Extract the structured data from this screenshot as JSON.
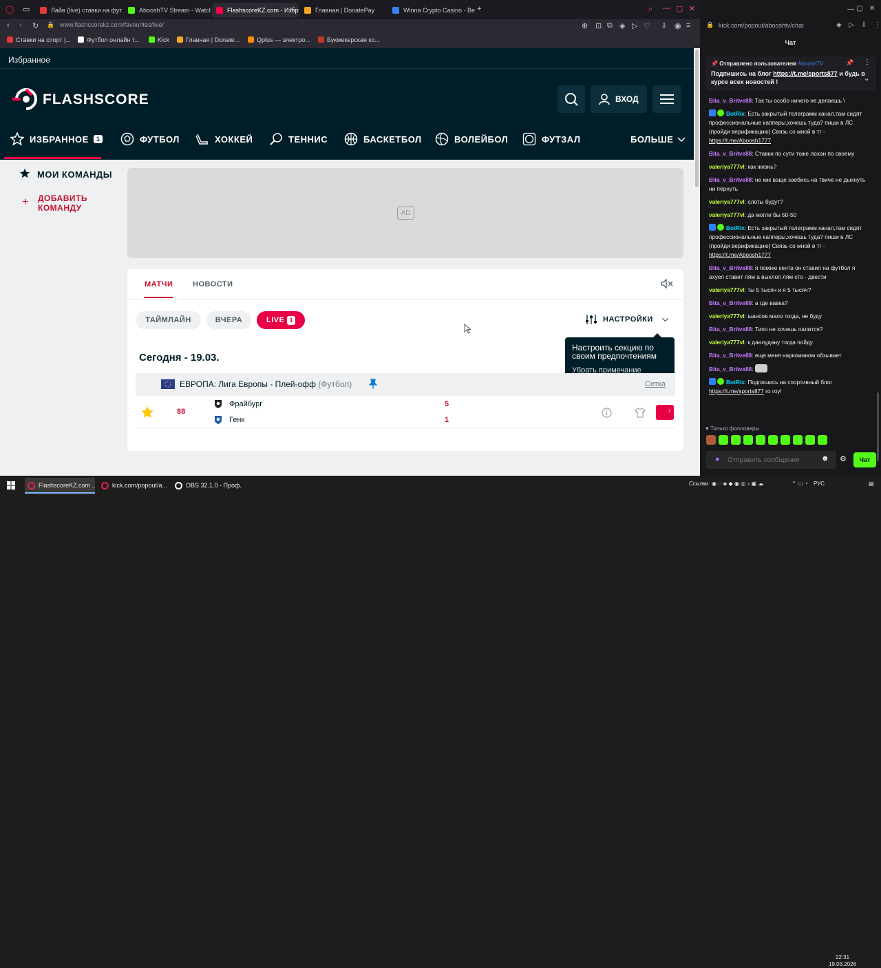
{
  "browser": {
    "tabs": [
      {
        "label": "Лайв (live) ставки на фут",
        "color": "#e53935"
      },
      {
        "label": "AbooshTV Stream - Watch",
        "color": "#53fc18"
      },
      {
        "label": "FlashscoreKZ.com - Избр",
        "color": "#ff0046"
      },
      {
        "label": "Главная | DonatePay",
        "color": "#f5a623"
      },
      {
        "label": "Winna Crypto Casino - Be",
        "color": "#3b82f6"
      }
    ],
    "url": "www.flashscorekz.com/favourites/live/",
    "bookmarks": [
      {
        "label": "Ставки на спорт |...",
        "color": "#e53935"
      },
      {
        "label": "Футбол онлайн т...",
        "color": "#ffffff"
      },
      {
        "label": "Kick",
        "color": "#53fc18"
      },
      {
        "label": "Главная | Donate...",
        "color": "#f5a623"
      },
      {
        "label": "Qplus — электро...",
        "color": "#ff8c00"
      },
      {
        "label": "Букмекерская ко...",
        "color": "#c0392b"
      }
    ]
  },
  "flashscore": {
    "favorites_header": "Избранное",
    "logo": "FLASHSCORE",
    "login": "ВХОД",
    "nav": [
      {
        "label": "ИЗБРАННОЕ",
        "badge": "1"
      },
      {
        "label": "ФУТБОЛ"
      },
      {
        "label": "ХОККЕЙ"
      },
      {
        "label": "ТЕННИС"
      },
      {
        "label": "БАСКЕТБОЛ"
      },
      {
        "label": "ВОЛЕЙБОЛ"
      },
      {
        "label": "ФУТЗАЛ"
      },
      {
        "label": "БОЛЬШЕ"
      }
    ],
    "sidebar": {
      "my_teams": "МОИ КОМАНДЫ",
      "add_team_line1": "ДОБАВИТЬ",
      "add_team_line2": "КОМАНДУ"
    },
    "ad_label": "AD",
    "content_tabs": [
      "МАТЧИ",
      "НОВОСТИ"
    ],
    "filters": {
      "timeline": "ТАЙМЛАЙН",
      "yesterday": "ВЧЕРА",
      "live": "LIVE",
      "live_count": "1"
    },
    "settings_label": "НАСТРОЙКИ",
    "tooltip": {
      "text": "Настроить секцию по своим предпочтениям",
      "dismiss": "Убрать примечание"
    },
    "date_heading": "Сегодня - 19.03.",
    "league": {
      "name": "ЕВРОПА: Лига Европы - Плей-офф",
      "sport": "(Футбол)",
      "bracket": "Сетка"
    },
    "match": {
      "minute": "88",
      "home": "Фрайбург",
      "away": "Генк",
      "home_score": "5",
      "away_score": "1"
    }
  },
  "chat": {
    "url": "kick.com/popout/abooshtv/chat",
    "title": "Чат",
    "pinned": {
      "sent_by": "Отправлено пользователем",
      "user": "AbooshTV",
      "text_before": "Подпишись на блог ",
      "link": "https://t.me/sports877",
      "text_after": " и будь в курсе всех новостей !"
    },
    "messages": [
      {
        "user": "Bita_v_Britve88",
        "type": "b",
        "text": "Так ты особо ничего не делаешь \\"
      },
      {
        "user": "BotRix",
        "type": "bot",
        "text": "Есть закрытый телеграмм канал,там сидят профессиональные капперы,хочешь туда? пиши в ЛС (пройди верификацию) Связь со мной в тг - ",
        "link": "https://t.me/Aboosh1777"
      },
      {
        "user": "Bita_v_Britve88",
        "type": "b",
        "text": "Ставки по сути тоже лохан по своему"
      },
      {
        "user": "valeriya777vl",
        "type": "v",
        "text": "как жизнь?"
      },
      {
        "user": "Bita_v_Britve88",
        "type": "b",
        "text": "не кик ваще заебись на твиче не дыхнуть ни пёрнуть"
      },
      {
        "user": "valeriya777vl",
        "type": "v",
        "text": "слоты будут?"
      },
      {
        "user": "valeriya777vl",
        "type": "v",
        "text": "да могли бы 50-50"
      },
      {
        "user": "BotRix",
        "type": "bot",
        "text": "Есть закрытый телеграмм канал,там сидят профессиональные капперы,хочешь туда? пиши в ЛС (пройди верификацию) Связь со мной в тг - ",
        "link": "https://t.me/Aboosh1777"
      },
      {
        "user": "Bita_v_Britve88",
        "type": "b",
        "text": "я помню кента он ставил на футбол я ахуел ставит лям а выхлоп лям сто - двести"
      },
      {
        "user": "valeriya777vl",
        "type": "v",
        "text": "ты 5 тысяч и я 5 тысяч?"
      },
      {
        "user": "Bita_v_Britve88",
        "type": "b",
        "text": "а где вавка?"
      },
      {
        "user": "valeriya777vl",
        "type": "v",
        "text": "шансов мало тогда, не буду"
      },
      {
        "user": "Bita_v_Britve88",
        "type": "b",
        "text": "Типо не хочешь палится?"
      },
      {
        "user": "valeriya777vl",
        "type": "v",
        "text": "к данлудану тогда пойду"
      },
      {
        "user": "Bita_v_Britve88",
        "type": "b",
        "text": "еще меня наркоманом обзывает"
      },
      {
        "user": "Bita_v_Britve88",
        "type": "b",
        "text": ""
      },
      {
        "user": "BotRix",
        "type": "bot",
        "text": "Подпишись на спортивный блог ",
        "link": "https://t.me/sports877",
        "after": " го гоу!"
      }
    ],
    "followers_only": "Только фолловеры",
    "input_placeholder": "Отправить сообщение",
    "send_button": "Чат"
  },
  "taskbar": {
    "items": [
      "FlashscoreKZ.com ...",
      "kick.com/popout/a...",
      "OBS 32.1.0 - Проф..."
    ],
    "links": "Ссылки",
    "lang": "РУС",
    "time": "22:31",
    "date": "19.03.2026"
  }
}
